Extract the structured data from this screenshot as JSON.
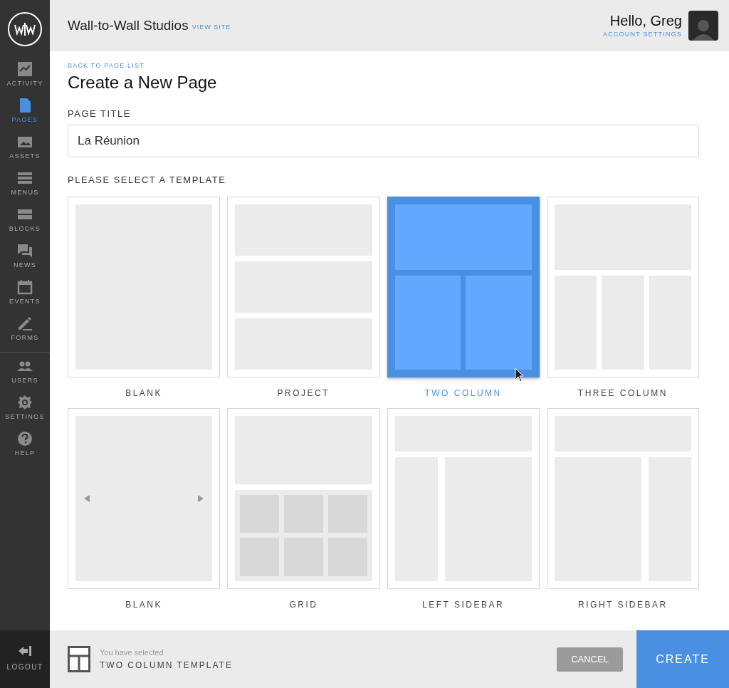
{
  "sidebar": {
    "items": [
      {
        "label": "ACTIVITY",
        "selected": false
      },
      {
        "label": "PAGES",
        "selected": true
      },
      {
        "label": "ASSETS",
        "selected": false
      },
      {
        "label": "MENUS",
        "selected": false
      },
      {
        "label": "BLOCKS",
        "selected": false
      },
      {
        "label": "NEWS",
        "selected": false
      },
      {
        "label": "EVENTS",
        "selected": false
      },
      {
        "label": "FORMS",
        "selected": false
      },
      {
        "label": "USERS",
        "selected": false
      },
      {
        "label": "SETTINGS",
        "selected": false
      },
      {
        "label": "HELP",
        "selected": false
      }
    ],
    "logout": "LOGOUT"
  },
  "header": {
    "site_name": "Wall-to-Wall Studios",
    "view_site": "VIEW SITE",
    "greeting": "Hello, Greg",
    "account_settings": "ACCOUNT SETTINGS"
  },
  "back_link": "BACK TO PAGE LIST",
  "heading": "Create a New Page",
  "page_title": {
    "label": "PAGE TITLE",
    "value": "La Réunion"
  },
  "template_prompt": "PLEASE SELECT A TEMPLATE",
  "templates": [
    {
      "kind": "blank",
      "label": "BLANK",
      "selected": false
    },
    {
      "kind": "project",
      "label": "PROJECT",
      "selected": false
    },
    {
      "kind": "two_column",
      "label": "TWO COLUMN",
      "selected": true
    },
    {
      "kind": "three_column",
      "label": "THREE COLUMN",
      "selected": false
    },
    {
      "kind": "carousel",
      "label": "BLANK",
      "selected": false
    },
    {
      "kind": "grid",
      "label": "GRID",
      "selected": false
    },
    {
      "kind": "left_sidebar",
      "label": "LEFT SIDEBAR",
      "selected": false
    },
    {
      "kind": "right_sidebar",
      "label": "RIGHT SIDEBAR",
      "selected": false
    }
  ],
  "footer": {
    "selected_hint": "You have selected",
    "selected_template": "TWO COLUMN TEMPLATE",
    "cancel": "CANCEL",
    "create": "CREATE"
  }
}
